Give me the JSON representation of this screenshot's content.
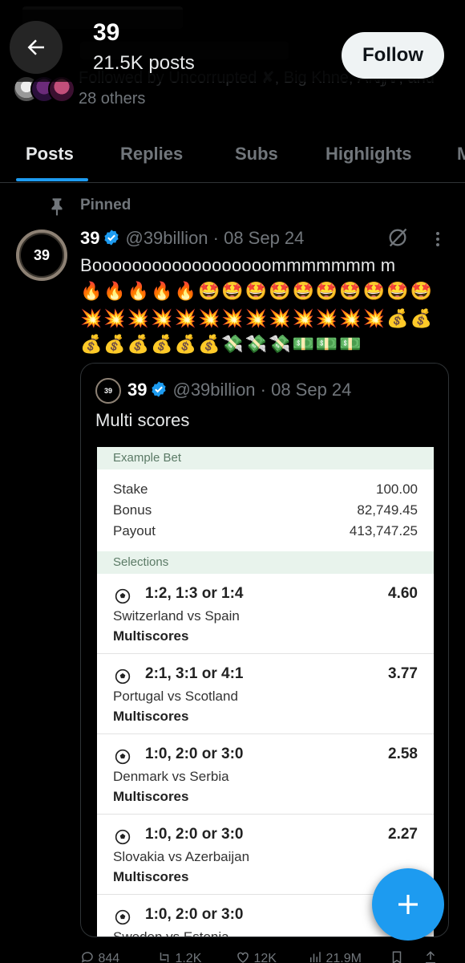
{
  "header": {
    "title": "39",
    "posts_count": "21.5K posts",
    "follow_label": "Follow"
  },
  "profile": {
    "followed_by_text": "Followed by Uncorrupted ✘, Big Khne, ₳ℕ𝕁𝕐, and",
    "followed_by_more": "28 others"
  },
  "tabs": [
    {
      "label": "Posts",
      "active": true
    },
    {
      "label": "Replies",
      "active": false
    },
    {
      "label": "Subs",
      "active": false
    },
    {
      "label": "Highlights",
      "active": false
    },
    {
      "label": "M",
      "active": false
    }
  ],
  "pinned": {
    "label": "Pinned"
  },
  "post": {
    "avatar_text": "39",
    "name": "39",
    "handle_date": "@39billion · 08 Sep 24",
    "text": "Boooooooooooooooooommmmmmm m",
    "emoji_rows": [
      "🔥🔥🔥🔥🔥🤩🤩🤩🤩🤩🤩🤩🤩🤩🤩",
      "💥💥💥💥💥💥💥💥💥💥💥💥💥💰💰",
      "💰💰💰💰💰💰💸💸💸💵💵💵"
    ]
  },
  "quote": {
    "avatar_text": "39",
    "name": "39",
    "handle_date": "@39billion · 08 Sep 24",
    "text": "Multi scores"
  },
  "betslip": {
    "example_label": "Example Bet",
    "rows": [
      {
        "label": "Stake",
        "value": "100.00"
      },
      {
        "label": "Bonus",
        "value": "82,749.45"
      },
      {
        "label": "Payout",
        "value": "413,747.25"
      }
    ],
    "selections_label": "Selections",
    "selections": [
      {
        "score": "1:2, 1:3 or 1:4",
        "odds": "4.60",
        "match": "Switzerland vs Spain",
        "market": "Multiscores"
      },
      {
        "score": "2:1, 3:1 or 4:1",
        "odds": "3.77",
        "match": "Portugal vs Scotland",
        "market": "Multiscores"
      },
      {
        "score": "1:0, 2:0 or 3:0",
        "odds": "2.58",
        "match": "Denmark vs Serbia",
        "market": "Multiscores"
      },
      {
        "score": "1:0, 2:0 or 3:0",
        "odds": "2.27",
        "match": "Slovakia vs Azerbaijan",
        "market": "Multiscores"
      },
      {
        "score": "1:0, 2:0 or 3:0",
        "odds": "",
        "match": "Sweden vs Estonia",
        "market": ""
      }
    ]
  },
  "actions": {
    "replies": "844",
    "reposts": "1.2K",
    "likes": "12K",
    "views": "21.9M"
  },
  "colors": {
    "accent": "#1d9bf0",
    "background": "#000000",
    "muted": "#71767b"
  },
  "icons": [
    "back-arrow-icon",
    "pin-icon",
    "verified-badge-icon",
    "grok-icon",
    "more-icon",
    "soccer-ball-icon",
    "compose-plus-icon",
    "reply-icon",
    "repost-icon",
    "like-icon",
    "views-icon",
    "bookmark-icon",
    "share-icon"
  ]
}
